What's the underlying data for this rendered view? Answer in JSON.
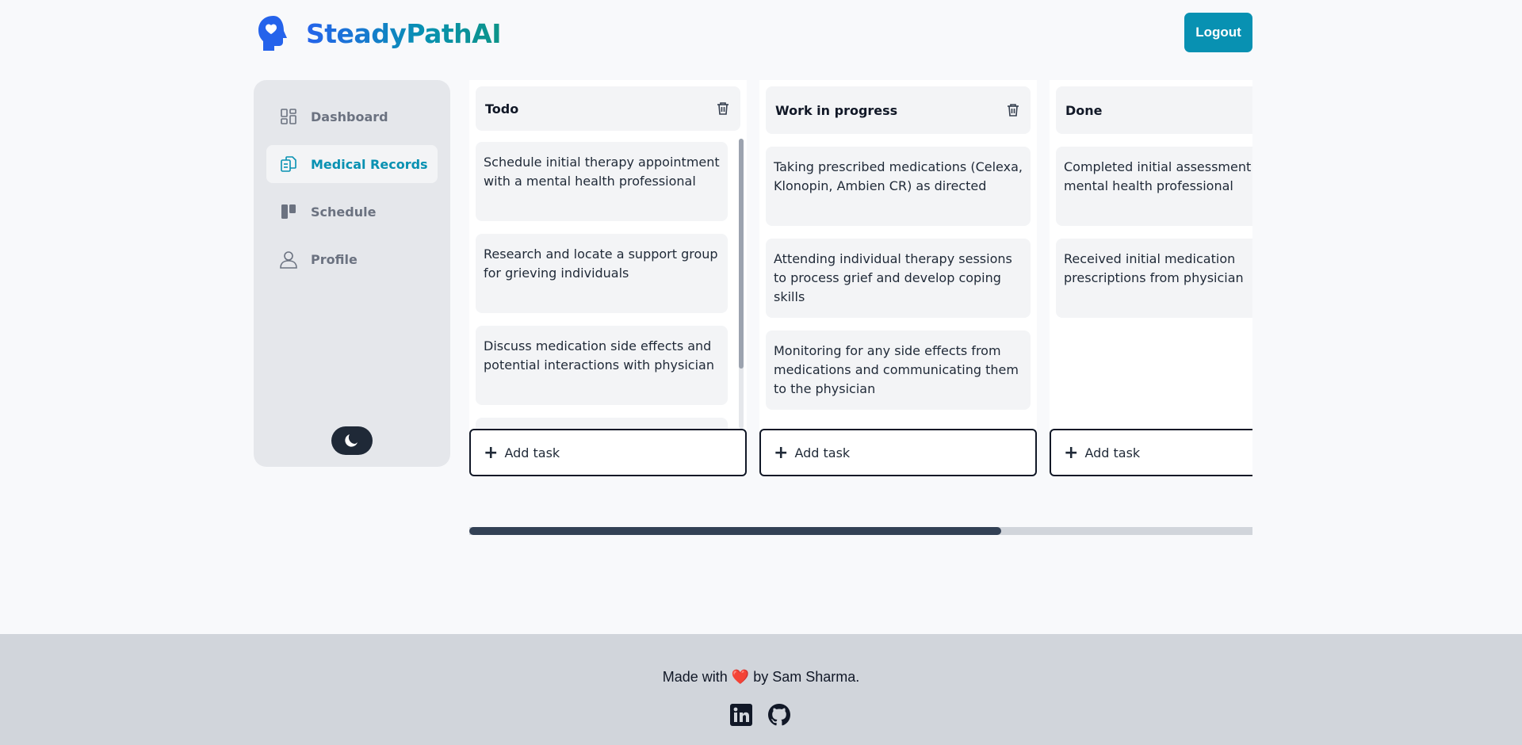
{
  "app": {
    "brand": "SteadyPathAI",
    "logout_label": "Logout",
    "colors": {
      "accent": "#0891b2",
      "brand_blue": "#2563eb"
    }
  },
  "sidebar": {
    "items": [
      {
        "label": "Dashboard",
        "icon": "dashboard-icon",
        "active": false
      },
      {
        "label": "Medical Records",
        "icon": "documents-icon",
        "active": true
      },
      {
        "label": "Schedule",
        "icon": "kanban-icon",
        "active": false
      },
      {
        "label": "Profile",
        "icon": "user-icon",
        "active": false
      }
    ],
    "theme_toggle_icon": "moon-icon"
  },
  "board": {
    "add_task_label": "Add task",
    "columns": [
      {
        "title": "Todo",
        "cards": [
          "Schedule initial therapy appointment with a mental health professional",
          "Research and locate a support group for grieving individuals",
          "Discuss medication side effects and potential interactions with physician"
        ]
      },
      {
        "title": "Work in progress",
        "cards": [
          "Taking prescribed medications (Celexa, Klonopin, Ambien CR) as directed",
          "Attending individual therapy sessions to process grief and develop coping skills",
          "Monitoring for any side effects from medications and communicating them to the physician"
        ]
      },
      {
        "title": "Done",
        "cards": [
          "Completed initial assessment with mental health professional",
          "Received initial medication prescriptions from physician"
        ]
      }
    ]
  },
  "footer": {
    "made_with": "Made with",
    "heart": "❤️",
    "by": "by Sam Sharma.",
    "socials": [
      "linkedin-icon",
      "github-icon"
    ]
  }
}
